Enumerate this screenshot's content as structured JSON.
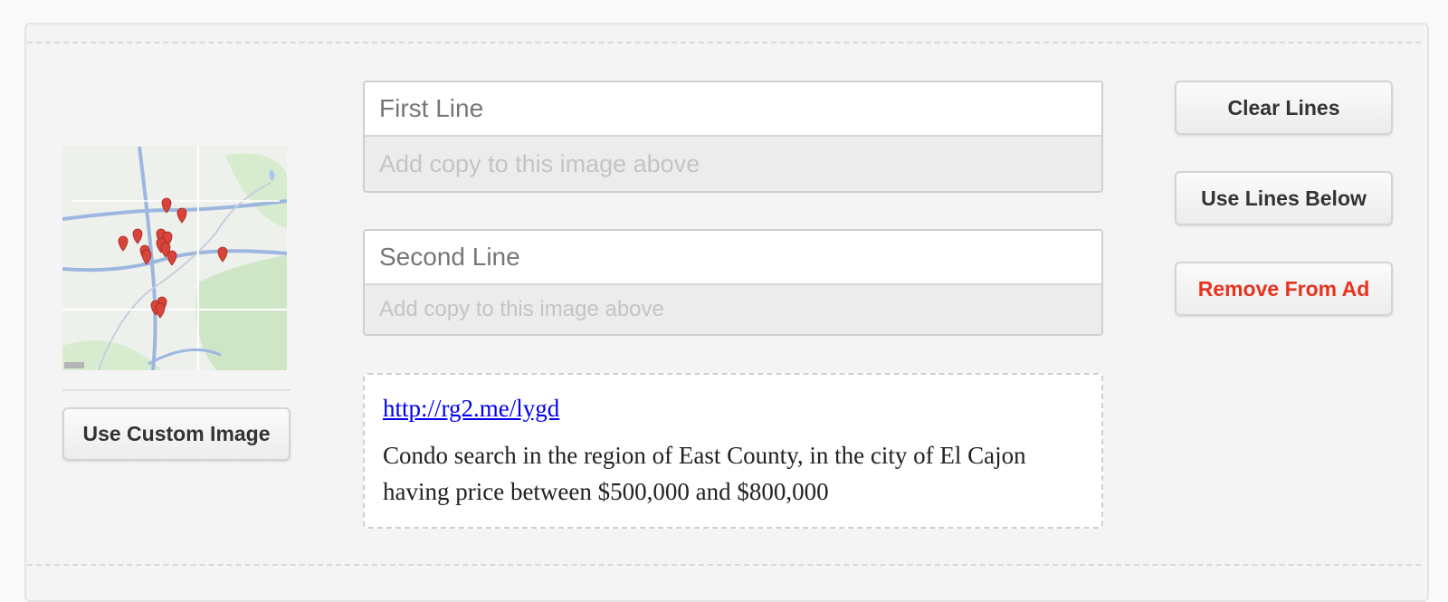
{
  "colors": {
    "remove_button_text": "#e8321f",
    "link": "#0000ee",
    "map_pin": "#d9443a",
    "map_background": "#eef0ec",
    "map_park": "#cfe6c6",
    "map_road": "#9bb7e0"
  },
  "image_panel": {
    "image_kind": "map-thumbnail",
    "use_custom_image_label": "Use Custom Image"
  },
  "line1": {
    "placeholder": "First Line",
    "sub_placeholder": "Add copy to this image above"
  },
  "line2": {
    "placeholder": "Second Line",
    "sub_placeholder": "Add copy to this image above"
  },
  "preview": {
    "link_text": "http://rg2.me/lygd",
    "description": "Condo search in the region of East County, in the city of El Cajon having price between $500,000 and $800,000"
  },
  "actions": {
    "clear_lines_label": "Clear Lines",
    "use_lines_below_label": "Use Lines Below",
    "remove_from_ad_label": "Remove From Ad"
  }
}
